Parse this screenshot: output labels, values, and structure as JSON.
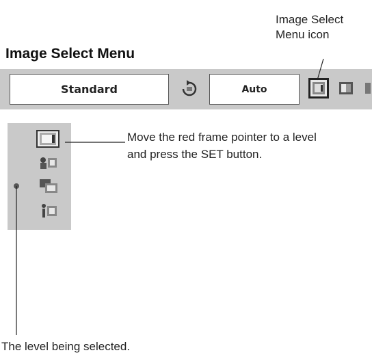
{
  "callout": {
    "line1": "Image Select",
    "line2": "Menu icon"
  },
  "title": "Image Select Menu",
  "toolbar": {
    "mode_value": "Standard",
    "auto_value": "Auto",
    "icons": [
      "rotate-icon",
      "image-select-icon",
      "contrast-icon",
      "next-icon"
    ]
  },
  "side_panel": {
    "levels": [
      "level-1-icon",
      "level-2-icon",
      "level-3-icon",
      "level-4-icon"
    ],
    "selected_level": 1
  },
  "instruction": {
    "line1": "Move the red frame pointer to a level",
    "line2": "and press the SET button."
  },
  "caption": "The level being selected.",
  "colors": {
    "panel": "#c9c9c9",
    "frame": "#222222"
  }
}
